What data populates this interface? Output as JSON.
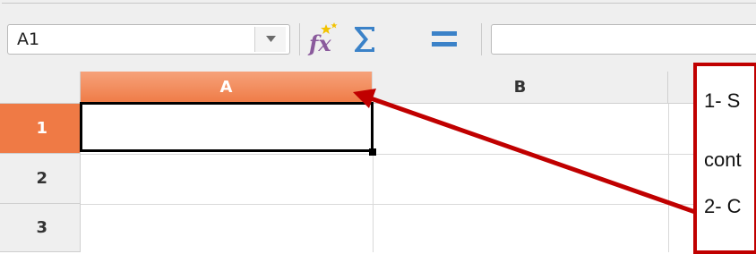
{
  "formula_bar": {
    "name_box": {
      "value": "A1"
    },
    "tools": [
      "function-wizard-icon",
      "sum-icon",
      "formula-equals-icon"
    ]
  },
  "grid": {
    "columns": [
      "A",
      "B"
    ],
    "rows": [
      "1",
      "2",
      "3"
    ],
    "active_cell": "A1"
  },
  "callout": {
    "lines": [
      "1- S",
      "cont",
      "2- C"
    ]
  },
  "colors": {
    "accent": "#ef7a45",
    "annotation": "#c00000"
  }
}
